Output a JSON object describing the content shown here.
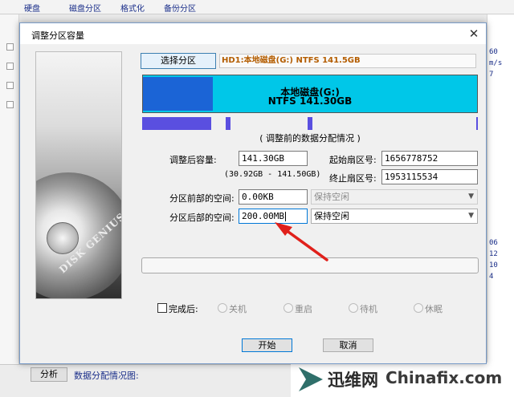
{
  "background": {
    "top_texts": [
      "硬盘",
      "磁盘分区",
      "格式化",
      "备份分区"
    ],
    "right_texts": [
      "60",
      "m/s",
      "7",
      "06",
      "12",
      "10",
      "4"
    ],
    "analyze_label": "分析",
    "data_map_label": "数据分配情况图:",
    "watermark_brand": "迅维网",
    "watermark_domain": "Chinafix.com"
  },
  "dialog": {
    "title": "调整分区容量",
    "side_brand": "DISK GENIUS",
    "select_partition_label": "选择分区",
    "disk_info": "HD1:本地磁盘(G:) NTFS 141.5GB",
    "partition": {
      "name": "本地磁盘(G:)",
      "size_text": "NTFS 141.30GB",
      "used_fraction": 0.21
    },
    "map_caption": "( 调整前的数据分配情况 )",
    "fields": {
      "new_capacity_label": "调整后容量:",
      "new_capacity_value": "141.30GB",
      "capacity_range": "(30.92GB - 141.50GB)",
      "start_sector_label": "起始扇区号:",
      "start_sector_value": "1656778752",
      "end_sector_label": "终止扇区号:",
      "end_sector_value": "1953115534",
      "space_before_label": "分区前部的空间:",
      "space_before_value": "0.00KB",
      "space_before_option": "保持空闲",
      "space_after_label": "分区后部的空间:",
      "space_after_value": "200.00MB",
      "space_after_option": "保持空闲"
    },
    "on_complete_label": "完成后:",
    "options": [
      "关机",
      "重启",
      "待机",
      "休眠"
    ],
    "start_label": "开始",
    "cancel_label": "取消"
  },
  "colors": {
    "partition_bar": "#00c7e8",
    "partition_used": "#1b64d6",
    "annotation_arrow": "#e0201b"
  }
}
